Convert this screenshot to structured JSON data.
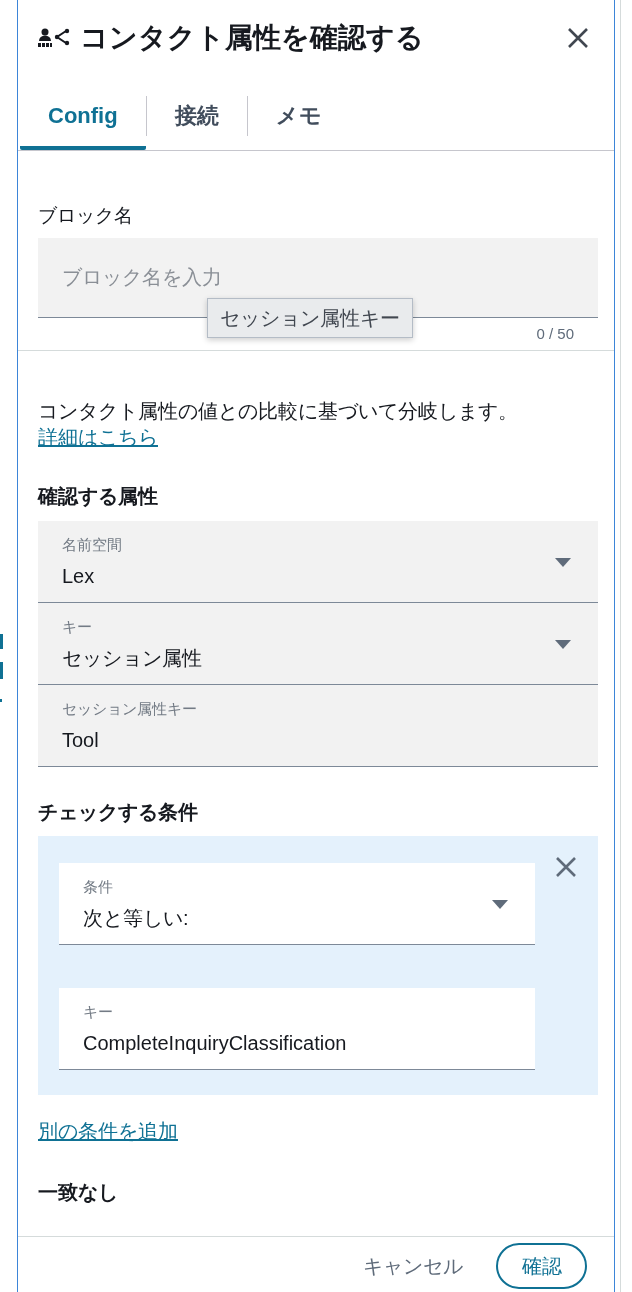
{
  "panel": {
    "title": "コンタクト属性を確認する"
  },
  "tabs": [
    {
      "label": "Config",
      "selected": true
    },
    {
      "label": "接続",
      "selected": false
    },
    {
      "label": "メモ",
      "selected": false
    }
  ],
  "block_name": {
    "label": "ブロック名",
    "placeholder": "ブロック名を入力",
    "counter": "0 / 50",
    "tooltip": "セッション属性キー"
  },
  "description": {
    "text": "コンタクト属性の値との比較に基づいて分岐します。",
    "link": "詳細はこちら"
  },
  "attribute_section": {
    "heading": "確認する属性",
    "fields": [
      {
        "kind": "select",
        "label": "名前空間",
        "value": "Lex"
      },
      {
        "kind": "select",
        "label": "キー",
        "value": "セッション属性"
      },
      {
        "kind": "text",
        "label": "セッション属性キー",
        "value": "Tool"
      }
    ]
  },
  "conditions_section": {
    "heading": "チェックする条件",
    "conditions": [
      {
        "fields": [
          {
            "kind": "select",
            "label": "条件",
            "value": "次と等しい:"
          },
          {
            "kind": "text",
            "label": "キー",
            "value": "CompleteInquiryClassification"
          }
        ]
      }
    ],
    "add_link": "別の条件を追加"
  },
  "no_match": {
    "heading": "一致なし"
  },
  "footer": {
    "buttons": [
      {
        "kind": "secondary",
        "label": "キャンセル"
      },
      {
        "kind": "primary",
        "label": "確認"
      }
    ]
  }
}
